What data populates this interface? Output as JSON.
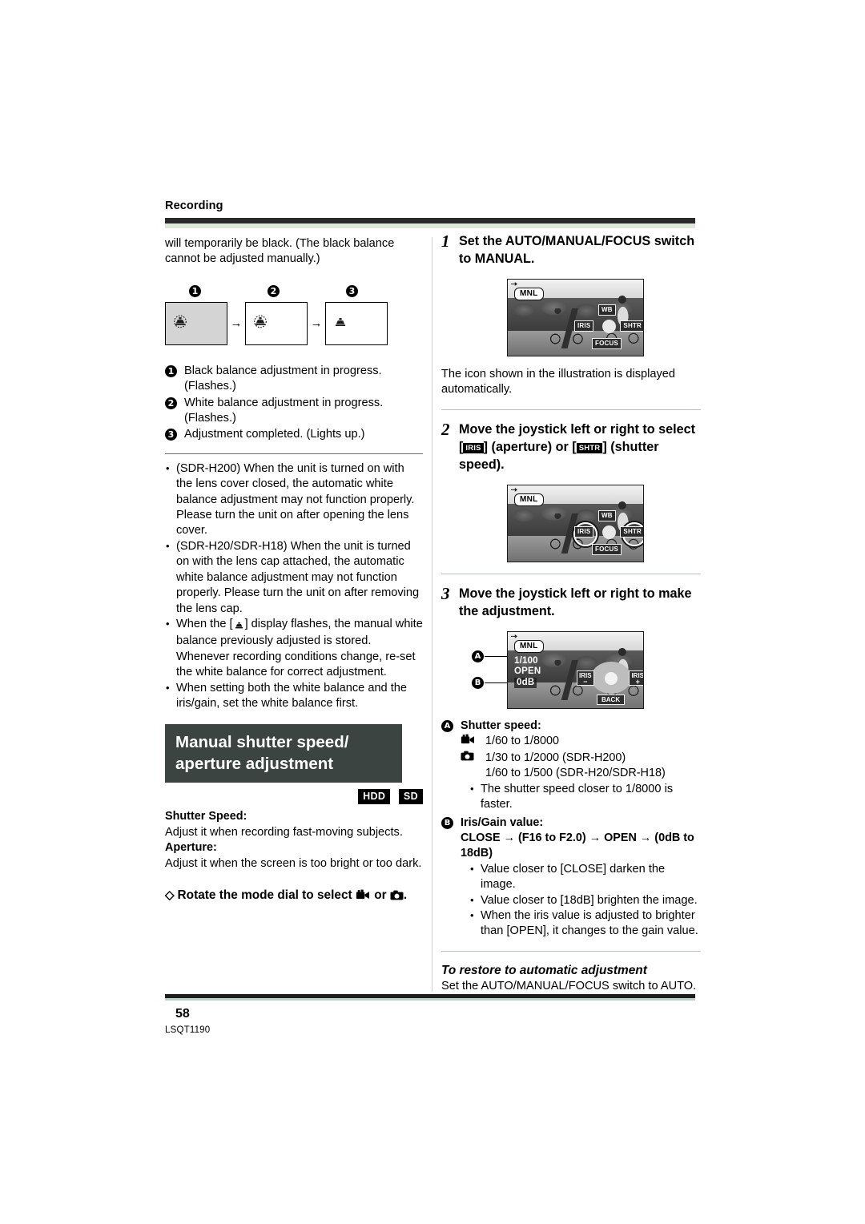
{
  "header": {
    "section_label": "Recording"
  },
  "left": {
    "intro": "will temporarily be black. (The black balance cannot be adjusted manually.)",
    "figure": {
      "marks": [
        "1",
        "2",
        "3"
      ],
      "arrow": "→"
    },
    "legend": [
      {
        "mark": "1",
        "text": "Black balance adjustment in progress. (Flashes.)"
      },
      {
        "mark": "2",
        "text": "White balance adjustment in progress. (Flashes.)"
      },
      {
        "mark": "3",
        "text": "Adjustment completed. (Lights up.)"
      }
    ],
    "notes": [
      "(SDR-H200) When the unit is turned on with the lens cover closed, the automatic white balance adjustment may not function properly. Please turn the unit on after opening the lens cover.",
      "(SDR-H20/SDR-H18) When the unit is turned on with the lens cap attached, the automatic white balance adjustment may not function properly. Please turn the unit on after removing the lens cap.",
      "When setting both the white balance and the iris/gain, set the white balance first."
    ],
    "note_wb_a": "When the [",
    "note_wb_b": "] display flashes, the manual white balance previously adjusted is stored. Whenever recording conditions change, re-set the white balance for correct adjustment.",
    "section_title": "Manual shutter speed/ aperture adjustment",
    "media_badges": [
      "HDD",
      "SD"
    ],
    "shutter_label": "Shutter Speed:",
    "shutter_desc": "Adjust it when recording fast-moving subjects.",
    "aperture_label": "Aperture:",
    "aperture_desc": "Adjust it when the screen is too bright or too dark.",
    "dial_diamond": "◇",
    "dial_text_a": "Rotate the mode dial to select",
    "dial_text_or": "or",
    "dial_text_end": "."
  },
  "right": {
    "steps": [
      {
        "num": "1",
        "title": "Set the AUTO/MANUAL/FOCUS switch to MANUAL.",
        "after": "The icon shown in the illustration is displayed automatically."
      },
      {
        "num": "2",
        "title_a": "Move the joystick left or right to select [",
        "title_iris": "IRIS",
        "title_b": "] (aperture) or [",
        "title_shtr": "SHTR",
        "title_c": "] (shutter speed)."
      },
      {
        "num": "3",
        "title": "Move the joystick left or right to make the adjustment."
      }
    ],
    "lcd": {
      "mnl": "MNL",
      "joy_top": "WB",
      "joy_left": "IRIS",
      "joy_right": "SHTR",
      "joy_bottom": "FOCUS",
      "shutter_value": "1/100",
      "iris_value": "OPEN",
      "gain_value": "0dB",
      "pad_left": "IRIS",
      "pad_left_sign": "−",
      "pad_right": "IRIS",
      "pad_right_sign": "+",
      "pad_back": "BACK",
      "callout_a": "A",
      "callout_b": "B"
    },
    "ab": {
      "a_mark": "A",
      "a_title": "Shutter speed:",
      "a_video_value": "1/60 to 1/8000",
      "a_still_value": "1/30 to 1/2000 (SDR-H200)",
      "a_still_value2": "1/60 to 1/500 (SDR-H20/SDR-H18)",
      "a_note": "The shutter speed closer to 1/8000 is faster.",
      "b_mark": "B",
      "b_title": "Iris/Gain value:",
      "b_range": "CLOSE → (F16 to F2.0) → OPEN → (0dB to 18dB)",
      "b_notes": [
        "Value closer to [CLOSE] darken the image.",
        "Value closer to [18dB] brighten the image.",
        "When the iris value is adjusted to brighter than [OPEN], it changes to the gain value."
      ]
    },
    "restore": {
      "title": "To restore to automatic adjustment",
      "text": "Set the AUTO/MANUAL/FOCUS switch to AUTO."
    }
  },
  "footer": {
    "page_number": "58",
    "doc_id": "LSQT1190"
  },
  "colors": {
    "section_bar": "#3b4441",
    "rule_dark": "#2a2a2a",
    "rule_tint": "#dfe6dc",
    "badge": "#000000"
  }
}
